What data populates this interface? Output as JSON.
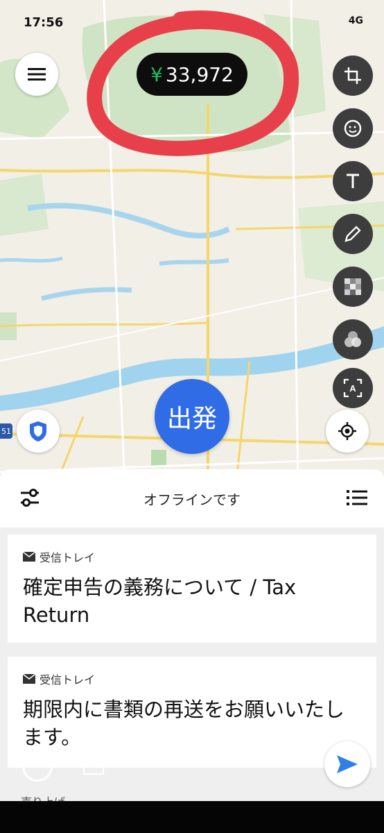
{
  "status_bar": {
    "time": "17:56",
    "network": "4G"
  },
  "earnings": {
    "currency": "¥",
    "amount": "33,972"
  },
  "go_button": {
    "label": "出発"
  },
  "map": {
    "route_marker": "51"
  },
  "panel": {
    "title": "オフラインです",
    "cards": [
      {
        "source": "受信トレイ",
        "message": "確定申告の義務について / Tax Return"
      },
      {
        "source": "受信トレイ",
        "message": "期限内に書類の再送をお願いいたします。"
      }
    ],
    "peek_text": "売り上げ"
  },
  "colors": {
    "accent": "#2f6ce6",
    "yen": "#1fbf61",
    "annotation": "#e8404a"
  }
}
